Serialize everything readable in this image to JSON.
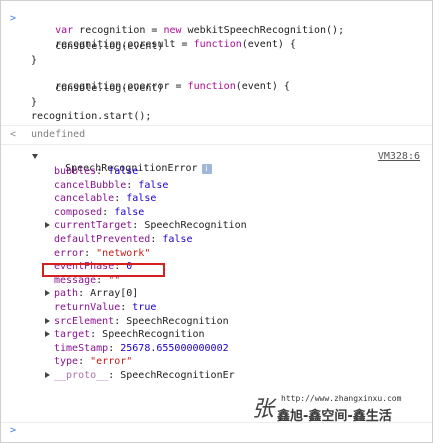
{
  "console": {
    "input_prompt": ">",
    "return_prompt": "<",
    "code_lines": [
      {
        "kw": "var",
        "rest": " recognition = ",
        "kw2": "new",
        "rest2": " webkitSpeechRecognition();"
      },
      {
        "pre": "recognition.onresult = ",
        "fn": "function",
        "post": "(event) {"
      },
      {
        "text": "    console.log(event)"
      },
      {
        "text": "}"
      },
      {
        "pre": "recognition.onerror = ",
        "fn": "function",
        "post": "(event) {"
      },
      {
        "text": "    console.log(event)"
      },
      {
        "text": "}"
      },
      {
        "text": "recognition.start();"
      }
    ],
    "return_value": "undefined",
    "object_name": "SpeechRecognitionError",
    "info_icon": "i",
    "source_link": "VM328:6",
    "properties": [
      {
        "key": "bubbles",
        "value": "false",
        "type": "bool",
        "expandable": false
      },
      {
        "key": "cancelBubble",
        "value": "false",
        "type": "bool",
        "expandable": false
      },
      {
        "key": "cancelable",
        "value": "false",
        "type": "bool",
        "expandable": false
      },
      {
        "key": "composed",
        "value": "false",
        "type": "bool",
        "expandable": false
      },
      {
        "key": "currentTarget",
        "value": "SpeechRecognition",
        "type": "obj",
        "expandable": true
      },
      {
        "key": "defaultPrevented",
        "value": "false",
        "type": "bool",
        "expandable": false
      },
      {
        "key": "error",
        "value": "\"network\"",
        "type": "str",
        "expandable": false
      },
      {
        "key": "eventPhase",
        "value": "0",
        "type": "num",
        "expandable": false
      },
      {
        "key": "message",
        "value": "\"\"",
        "type": "str",
        "expandable": false
      },
      {
        "key": "path",
        "value": "Array[0]",
        "type": "obj",
        "expandable": true
      },
      {
        "key": "returnValue",
        "value": "true",
        "type": "bool",
        "expandable": false
      },
      {
        "key": "srcElement",
        "value": "SpeechRecognition",
        "type": "obj",
        "expandable": true
      },
      {
        "key": "target",
        "value": "SpeechRecognition",
        "type": "obj",
        "expandable": true
      },
      {
        "key": "timeStamp",
        "value": "25678.655000000002",
        "type": "num",
        "expandable": false
      },
      {
        "key": "type",
        "value": "\"error\"",
        "type": "str",
        "expandable": false
      },
      {
        "key": "__proto__",
        "value": "SpeechRecognitionEr",
        "type": "obj",
        "expandable": true
      }
    ],
    "input_caret": ">"
  },
  "watermark": {
    "url": "http://www.zhangxinxu.com",
    "mark": "张",
    "text": "鑫旭-鑫空间-鑫生活"
  },
  "colors": {
    "highlight_border": "#d42020",
    "prompt_blue": "#3b78e7",
    "keyword": "#aa0d91",
    "property_key": "#881391",
    "bool_num": "#1c00cf",
    "string": "#c41a16"
  }
}
